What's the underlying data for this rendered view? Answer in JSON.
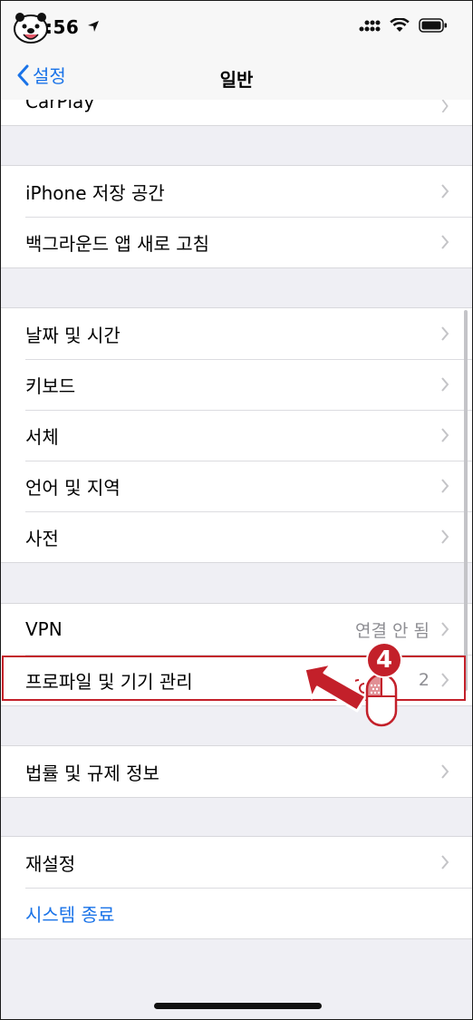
{
  "status_bar": {
    "time": ":56"
  },
  "nav": {
    "back_label": "설정",
    "title": "일반"
  },
  "sections": [
    {
      "rows": [
        {
          "label": "CarPlay"
        }
      ]
    },
    {
      "rows": [
        {
          "label": "iPhone 저장 공간"
        },
        {
          "label": "백그라운드 앱 새로 고침"
        }
      ]
    },
    {
      "rows": [
        {
          "label": "날짜 및 시간"
        },
        {
          "label": "키보드"
        },
        {
          "label": "서체"
        },
        {
          "label": "언어 및 지역"
        },
        {
          "label": "사전"
        }
      ]
    },
    {
      "rows": [
        {
          "label": "VPN",
          "value": "연결 안 됨"
        },
        {
          "label": "프로파일 및 기기 관리",
          "value": "2"
        }
      ]
    },
    {
      "rows": [
        {
          "label": "법률 및 규제 정보"
        }
      ]
    },
    {
      "rows": [
        {
          "label": "재설정"
        },
        {
          "label": "시스템 종료"
        }
      ]
    }
  ],
  "annotation": {
    "step": "4"
  },
  "colors": {
    "accent": "#1a73e8",
    "highlight": "#c3202a",
    "background": "#efeff4"
  }
}
